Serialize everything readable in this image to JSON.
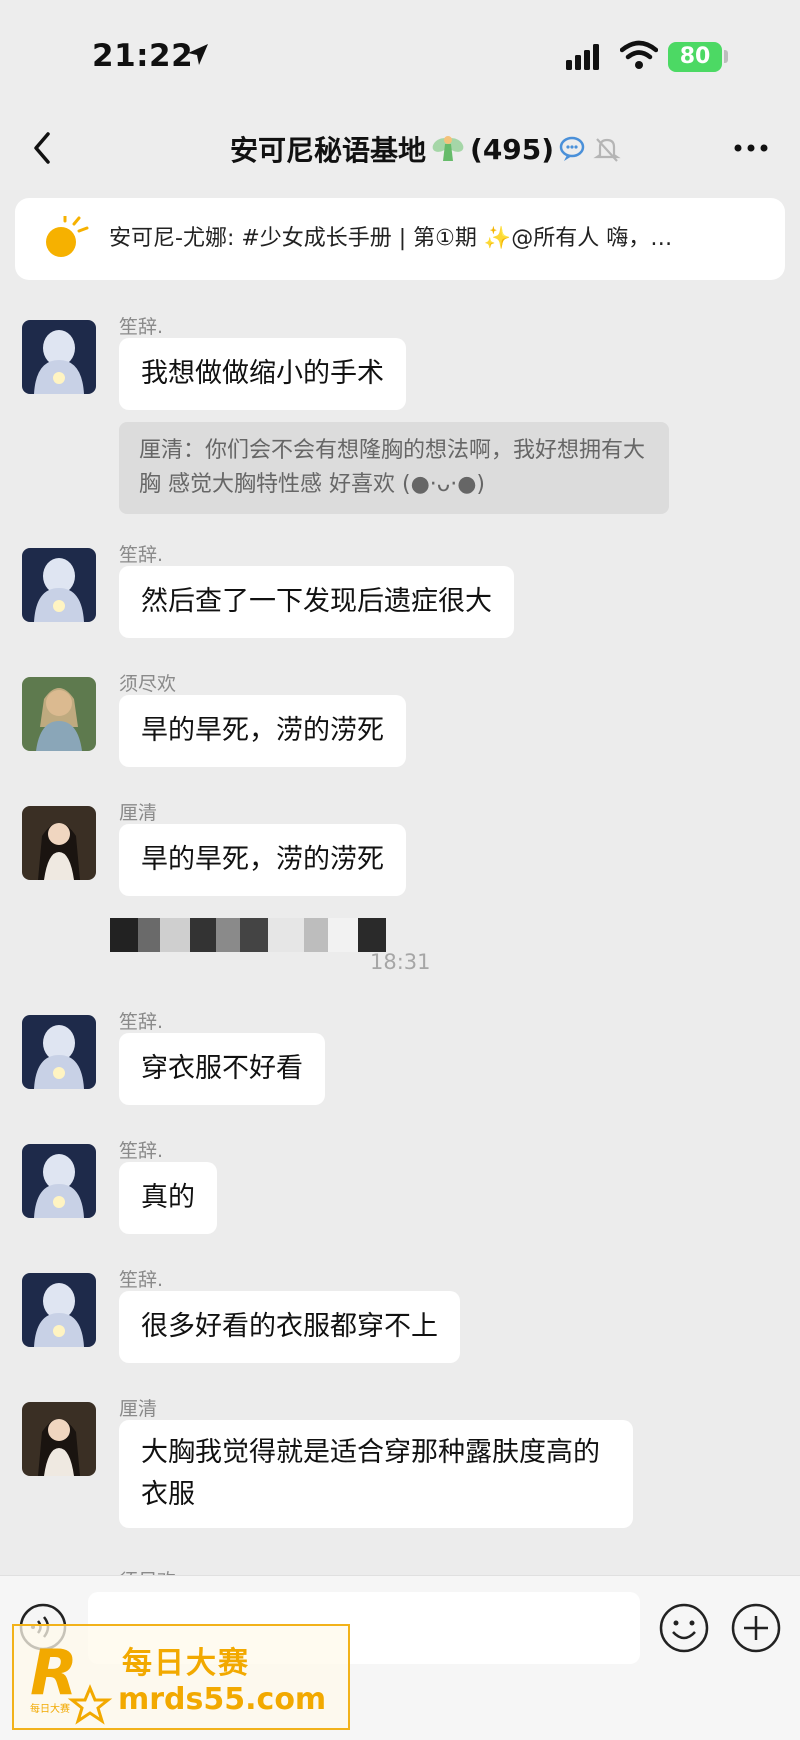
{
  "status_bar": {
    "time": "21:22",
    "battery": "80"
  },
  "header": {
    "back_label": "<",
    "title": "安可尼秘语基地",
    "member_count": "(495)",
    "more_label": "···"
  },
  "pinned": {
    "text": "安可尼-尤娜: #少女成长手册 | 第①期 ✨@所有人  嗨，…"
  },
  "messages": [
    {
      "sender": "笙辞.",
      "text": "我想做做缩小的手术",
      "quote": "厘清：你们会不会有想隆胸的想法啊，我好想拥有大胸 感觉大胸特性感 好喜欢 (●·ᴗ·●)"
    },
    {
      "sender": "笙辞.",
      "text": "然后查了一下发现后遗症很大"
    },
    {
      "sender": "须尽欢",
      "text": "旱的旱死，涝的涝死"
    },
    {
      "sender": "厘清",
      "text": "旱的旱死，涝的涝死"
    },
    {
      "sender": "笙辞.",
      "text": "穿衣服不好看"
    },
    {
      "sender": "笙辞.",
      "text": "真的"
    },
    {
      "sender": "笙辞.",
      "text": "很多好看的衣服都穿不上"
    },
    {
      "sender": "厘清",
      "text": "大胸我觉得就是适合穿那种露肤度高的衣服"
    },
    {
      "sender": "须尽欢"
    }
  ],
  "timestamp": "18:31",
  "input": {
    "value": ""
  },
  "watermark": {
    "name": "每日大赛",
    "url": "mrds55.com",
    "logo_letter": "R",
    "logo_small": "每日大赛"
  },
  "colors": {
    "background": "#ececec",
    "bubble": "#ffffff",
    "battery": "#4cd964",
    "watermark": "#f2a900"
  },
  "icons": [
    "location-arrow-icon",
    "signal-icon",
    "wifi-icon",
    "back-icon",
    "fairy-emoji-icon",
    "group-chat-icon",
    "mute-bell-icon",
    "more-icon",
    "sun-icon",
    "voice-icon",
    "emoji-icon",
    "plus-icon"
  ]
}
